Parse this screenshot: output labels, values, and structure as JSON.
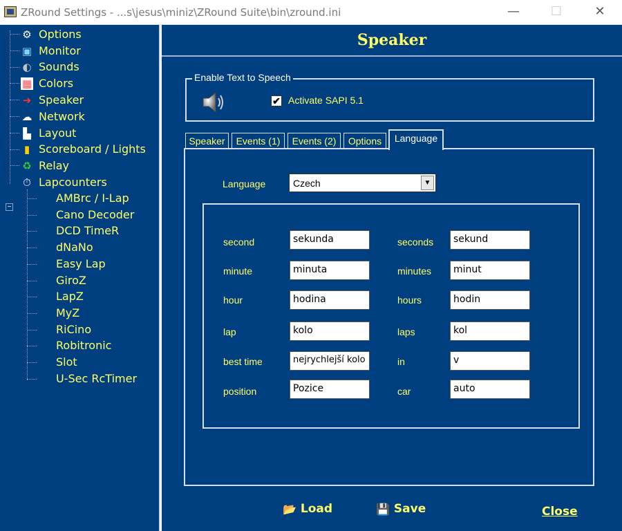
{
  "window": {
    "title": "ZRound Settings - ...s\\jesus\\miniz\\ZRound Suite\\bin\\zround.ini",
    "minimize_glyph": "—",
    "maximize_glyph": "☐",
    "close_glyph": "✕"
  },
  "tree": {
    "items": [
      {
        "label": "Options",
        "icon": "gear-icon",
        "glyph": "⚙"
      },
      {
        "label": "Monitor",
        "icon": "monitor-icon",
        "glyph": "▣"
      },
      {
        "label": "Sounds",
        "icon": "speaker-icon",
        "glyph": "◐"
      },
      {
        "label": "Colors",
        "icon": "palette-icon",
        "glyph": "▦"
      },
      {
        "label": "Speaker",
        "icon": "arrow-right-icon",
        "glyph": "➜"
      },
      {
        "label": "Network",
        "icon": "network-icon",
        "glyph": "☁"
      },
      {
        "label": "Layout",
        "icon": "layout-icon",
        "glyph": "▙"
      },
      {
        "label": "Scoreboard / Lights",
        "icon": "traffic-light-icon",
        "glyph": "▮"
      },
      {
        "label": "Relay",
        "icon": "relay-icon",
        "glyph": "♻"
      },
      {
        "label": "Lapcounters",
        "icon": "stopwatch-icon",
        "glyph": "⏱"
      }
    ],
    "expander_glyph": "−",
    "lapcounters": [
      "AMBrc / I-Lap",
      "Cano Decoder",
      "DCD TimeR",
      "dNaNo",
      "Easy Lap",
      "GiroZ",
      "LapZ",
      "MyZ",
      "RiCino",
      "Robitronic",
      "Slot",
      "U-Sec RcTimer"
    ]
  },
  "main": {
    "title": "Speaker",
    "tts_group": {
      "legend": "Enable Text to Speech",
      "checkbox_label": "Activate SAPI 5.1",
      "checked": true,
      "check_glyph": "✔"
    },
    "tabs": [
      "Speaker",
      "Events (1)",
      "Events (2)",
      "Options",
      "Language"
    ],
    "active_tab": "Language",
    "language": {
      "label": "Language",
      "selected": "Czech",
      "arrow_glyph": "▼"
    },
    "translations": {
      "left": [
        {
          "label": "second",
          "value": "sekunda"
        },
        {
          "label": "minute",
          "value": "minuta"
        },
        {
          "label": "hour",
          "value": "hodina"
        },
        {
          "label": "lap",
          "value": "kolo"
        },
        {
          "label": "best time",
          "value": "nejrychlejší kolo"
        },
        {
          "label": "position",
          "value": "Pozice"
        }
      ],
      "right": [
        {
          "label": "seconds",
          "value": "sekund"
        },
        {
          "label": "minutes",
          "value": "minut"
        },
        {
          "label": "hours",
          "value": "hodin"
        },
        {
          "label": "laps",
          "value": "kol"
        },
        {
          "label": "in",
          "value": "v"
        },
        {
          "label": "car",
          "value": "auto"
        }
      ]
    },
    "buttons": {
      "load": "Load",
      "save": "Save",
      "close": "Close",
      "load_glyph": "📂",
      "save_glyph": "💾"
    }
  },
  "colors": {
    "background": "#003f7f",
    "text_accent": "#ffff66",
    "border": "#d7e0ee"
  }
}
